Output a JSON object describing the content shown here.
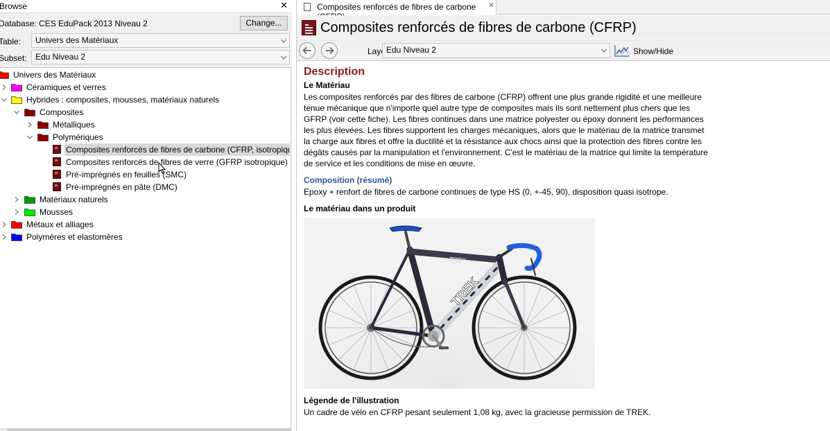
{
  "browse": {
    "title": "Browse",
    "database_label": "Database: CES EduPack 2013 Niveau 2",
    "change_button": "Change...",
    "table_label": "Table:",
    "table_value": "Univers des Matériaux",
    "subset_label": "Subset:",
    "subset_value": "Edu Niveau 2"
  },
  "tree": {
    "root": "Univers des Matériaux",
    "ceramics": "Céramiques et verres",
    "hybrids": "Hybrides : composites, mousses, matériaux naturels",
    "composites": "Composites",
    "metalliques": "Métalliques",
    "polymeriques": "Polymériques",
    "cfrp": "Composites renforcés de fibres de carbone (CFRP, isotropique)",
    "gfrp": "Composites renforcés de fibres de verre (GFRP isotropique)",
    "smc": "Pré-imprégnés en feuilles (SMC)",
    "dmc": "Pré-imprégnés en pâte (DMC)",
    "natural": "Matériaux naturels",
    "foams": "Mousses",
    "metals": "Métaux et alliages",
    "polymers": "Polymères et elastomères"
  },
  "colors": {
    "red": "#ff0000",
    "magenta": "#ff00ff",
    "yellow": "#ffff00",
    "darkred": "#8b0000",
    "green": "#00a000",
    "lime": "#00ee00",
    "blue": "#0000ff",
    "description": "#8b1a1a",
    "composition": "#2f5597"
  },
  "tab": {
    "title": "Composites renforcés de fibres de carbone (CFRP)",
    "close": "×"
  },
  "record": {
    "title": "Composites renforcés de fibres de carbone (CFRP)"
  },
  "toolbar": {
    "layout_label": "Layout:",
    "layout_value": "Edu Niveau 2",
    "showhide": "Show/Hide"
  },
  "content": {
    "description_heading": "Description",
    "material_heading": "Le Matériau",
    "material_lines": [
      "Les composites renforcés par des fibres de carbone (CFRP) offrent une plus grande rigidité et une meilleure",
      "tenue mécanique que n'importe quel autre type de composites mais ils sont nettement plus chers que les",
      "GFRP (voir cette fiche). Les fibres continues dans une matrice polyester ou époxy donnent les performances",
      "les plus élevées. Les fibres supportent les charges mécaniques, alors que le matériau de la matrice transmet",
      "la charge aux fibres et offre la ductilité et la résistance aux chocs ainsi que la protection des fibres contre les",
      "dégâts causés par la manipulation et l'environnement. C'est le matériau de la matrice qui limite la température",
      "de service et les conditions de mise en œuvre."
    ],
    "composition_heading": "Composition (résumé)",
    "composition_text": "Epoxy + renfort de fibres de carbone continues de type HS (0, +-45, 90), disposition quasi isotrope.",
    "product_heading": "Le matériau dans un produit",
    "bike_brand": "TREK",
    "legend_heading": "Légende de l'illustration",
    "legend_text": "Un cadre de vélo en CFRP pesant seulement 1,08 kg, avec la gracieuse permission de TREK."
  }
}
